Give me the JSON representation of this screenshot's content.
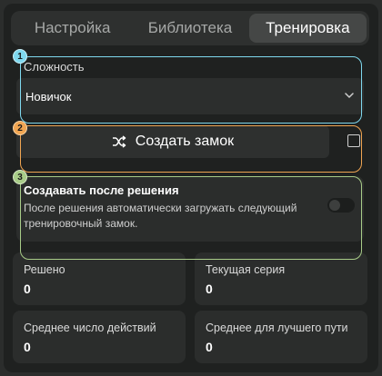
{
  "tabs": [
    {
      "label": "Настройка",
      "active": false
    },
    {
      "label": "Библиотека",
      "active": false
    },
    {
      "label": "Тренировка",
      "active": true
    }
  ],
  "difficulty": {
    "label": "Сложность",
    "value": "Новичок"
  },
  "create": {
    "label": "Создать замок",
    "icon": "shuffle-icon"
  },
  "auto_create": {
    "title": "Создавать после решения",
    "description": "После решения автоматически загружать следующий тренировочный замок.",
    "enabled": false
  },
  "stats": [
    {
      "label": "Решено",
      "value": "0"
    },
    {
      "label": "Текущая серия",
      "value": "0"
    },
    {
      "label": "Среднее число действий",
      "value": "0"
    },
    {
      "label": "Среднее для лучшего пути",
      "value": "0"
    }
  ],
  "annotations": [
    {
      "number": "1",
      "color": "#7fd8ee"
    },
    {
      "number": "2",
      "color": "#f0a552"
    },
    {
      "number": "3",
      "color": "#a8cc88"
    }
  ]
}
